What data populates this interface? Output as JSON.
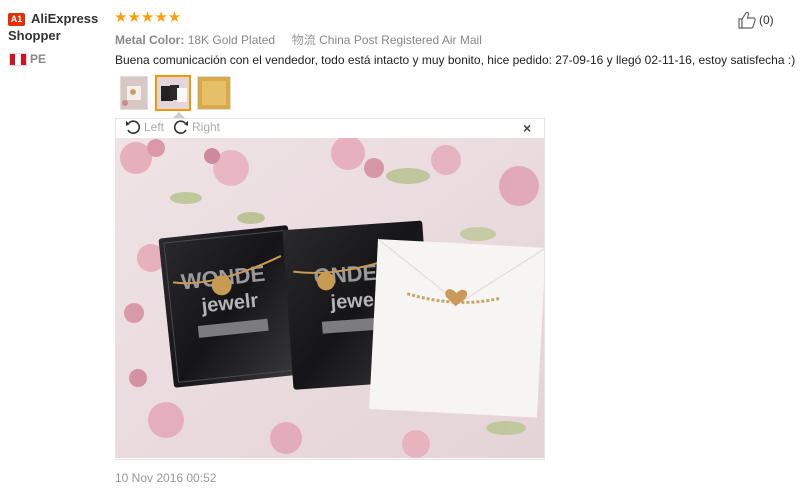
{
  "user": {
    "badge": "A1",
    "name_line1": "AliExpress",
    "name_line2": "Shopper",
    "country": "PE"
  },
  "review": {
    "stars": "★★★★★",
    "rating": 5,
    "metal_label": "Metal Color:",
    "metal_value": "18K Gold Plated",
    "shipping_icon": "物流",
    "shipping_value": "China Post Registered Air Mail",
    "text": "Buena comunicación con el vendedor, todo está intacto y muy bonito, hice pedido: 27-09-16 y llegó 02-11-16, estoy satisfecha :)",
    "date": "10 Nov 2016 00:52"
  },
  "helpful": {
    "icon": "thumbs-up-icon",
    "count": "(0)"
  },
  "viewer": {
    "rotate_left": "Left",
    "rotate_right": "Right",
    "close": "×"
  },
  "photo": {
    "package_brand_1": "WONDE",
    "package_sub_1": "jewelr",
    "package_brand_2": "ONDE",
    "package_sub_2": "jewe"
  },
  "colors": {
    "accent": "#ff9e0d",
    "badge": "#e62e04",
    "active_thumb_border": "#f39800"
  }
}
